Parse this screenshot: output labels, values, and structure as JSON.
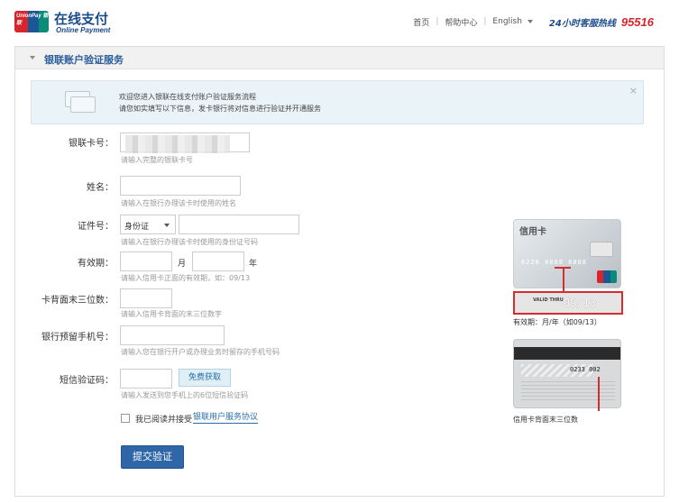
{
  "header": {
    "logo_text": "UnionPay 银联",
    "brand_cn": "在线支付",
    "brand_en": "Online Payment",
    "nav": {
      "home": "首页",
      "help": "帮助中心",
      "language": "English"
    },
    "hotline_label": "24小时客服热线",
    "hotline_number": "95516"
  },
  "panel": {
    "title": "银联账户验证服务"
  },
  "notice": {
    "line1": "欢迎您进入银联在线支付账户验证服务流程",
    "line2": "请您如实填写以下信息，发卡银行将对信息进行验证并开通服务",
    "close": "×"
  },
  "form": {
    "card_number": {
      "label": "银联卡号：",
      "hint": "请输入完整的银联卡号"
    },
    "name": {
      "label": "姓名：",
      "value": "",
      "hint": "请输入在银行办理该卡时使用的姓名"
    },
    "id": {
      "label": "证件号：",
      "type_selected": "身份证",
      "value": "",
      "hint": "请输入在银行办理该卡时使用的身份证号码"
    },
    "expiry": {
      "label": "有效期：",
      "month_unit": "月",
      "year_unit": "年",
      "hint": "请输入信用卡正面的有效期，如：09/13"
    },
    "cvn": {
      "label": "卡背面末三位数：",
      "hint": "请输入信用卡背面的末三位数字"
    },
    "phone": {
      "label": "银行预留手机号：",
      "hint": "请输入您在银行开户或办理业务时留存的手机号码"
    },
    "sms": {
      "label": "短信验证码：",
      "button": "免费获取",
      "hint": "请输入发送到您手机上的6位短信验证码"
    },
    "agree_text": "我已阅读并接受",
    "agree_link": "银联用户服务协议",
    "submit": "提交验证"
  },
  "illustration": {
    "front_title": "信用卡",
    "front_number": "6228 8888 8888",
    "valid_label": "VALID THRU",
    "valid_date": "09/13",
    "front_caption": "有效期：月/年（如09/13）",
    "back_cvv": "0233 002",
    "back_caption": "信用卡背面末三位数"
  },
  "colors": {
    "brand_blue": "#1a4b8c",
    "hotline_red": "#d7252b",
    "submit_blue": "#2e66a8",
    "highlight_red": "#d42d2d"
  }
}
